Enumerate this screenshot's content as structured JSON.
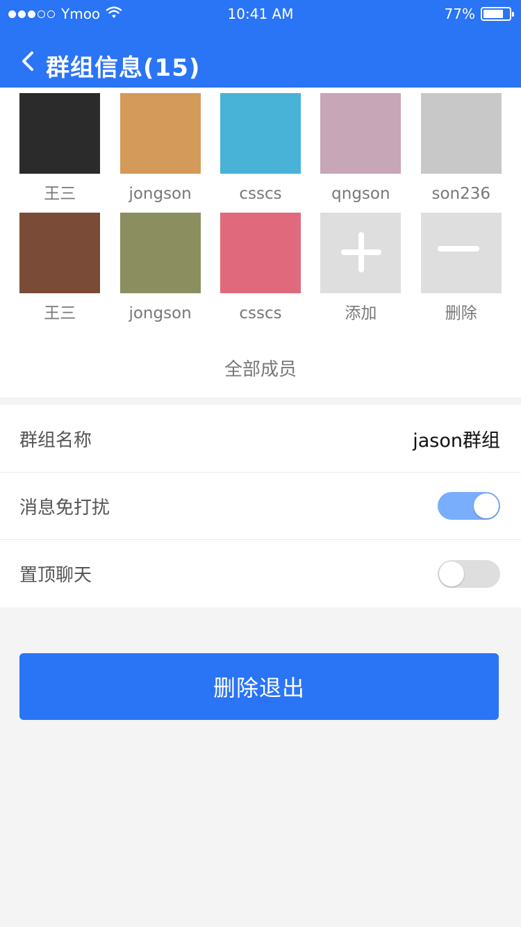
{
  "status_bar": {
    "carrier": "Ymoo",
    "time": "10:41 AM",
    "battery_text": "77%",
    "battery_level": 0.77
  },
  "nav": {
    "title": "群组信息(15)"
  },
  "members": [
    {
      "name": "王三",
      "avatar_color": "#2b2b2b"
    },
    {
      "name": "jongson",
      "avatar_color": "#d39a5a"
    },
    {
      "name": "csscs",
      "avatar_color": "#48b3d6"
    },
    {
      "name": "qngson",
      "avatar_color": "#c7a6b8"
    },
    {
      "name": "son236",
      "avatar_color": "#c8c8c8"
    },
    {
      "name": "王三",
      "avatar_color": "#7a4c38"
    },
    {
      "name": "jongson",
      "avatar_color": "#8b8f5f"
    },
    {
      "name": "csscs",
      "avatar_color": "#e06a7c"
    }
  ],
  "actions": {
    "add_label": "添加",
    "remove_label": "删除"
  },
  "all_members_label": "全部成员",
  "settings": {
    "group_name_label": "群组名称",
    "group_name_value": "jason群组",
    "mute_label": "消息免打扰",
    "mute_on": true,
    "pin_label": "置顶聊天",
    "pin_on": false
  },
  "exit_button_label": "删除退出",
  "colors": {
    "primary": "#2a74f6",
    "toggle_on": "#78aefc",
    "toggle_off": "#dedede"
  }
}
